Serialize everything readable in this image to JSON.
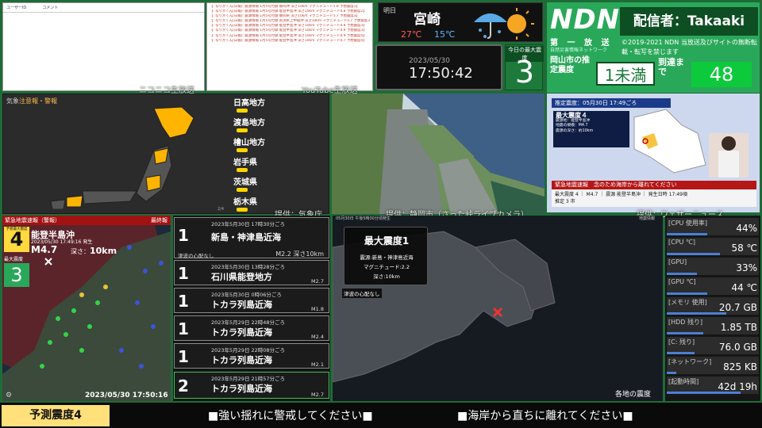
{
  "comments": {
    "col1": "ユーザーID",
    "col2": "コメント"
  },
  "log_lines": [
    "【: なりかくん[日報]: 震源情報 1月5号付録 静岡沖 深さ10km マグニチュード5.8 予想震度1】",
    "【: なりかくん[日報]: 震源情報 1月5号付録 能登半島沖 深さ10km マグニチュード4.8 予想震度2】",
    "【: なりかくん[日報]: 震源情報 1月5号付録 静岡県 深さ10km マグニチュード5.7 予想震度3】",
    "【: なりかくん[日報]: 震源情報 1月5号付録 新潟県上中越沖 深さ10km マグニチュード5.7 予想震度3】",
    "【: なりかくん[日報]: 震源情報 1月5号付録 能登半島沖 深さ10km マグニチュード4.8 予想震度3】",
    "【: なりかくん[日報]: 震源情報 1月5号付録 能登半島沖 深さ10km マグニチュード4.9 予想震度3】",
    "【: なりかくん[日報]: 震源情報 1月5号付録 能登半島沖 深さ10km マグニチュード4.9 予想震度4】",
    "【: なりかくん[日報]: 震源情報 1月5号付録 能登半島沖 深さ10km マグニチュード4.7 予想震度4】"
  ],
  "overlay": {
    "niconico": "ニコニコ生放送",
    "youtube": "YouTube生放送"
  },
  "weather": {
    "day": "明日",
    "city": "宮崎",
    "high": "27℃",
    "low": "15℃"
  },
  "clock": {
    "date": "2023/05/30",
    "time": "17:50:42"
  },
  "max_intensity": {
    "label": "今日の最大震度",
    "value": "3"
  },
  "header": {
    "logo": "NDN",
    "streamer": "配信者：Takaaki",
    "sub1": "第 一 放 送",
    "sub2": "自然災害情報ネットワーク",
    "copyright": "©2019-2021 NDN 当放送及びサイトの無断転載・転写を禁じます",
    "estimated_label": "岡山市の推定震度",
    "estimated_value": "1未満",
    "arrival_label": "到達まで",
    "arrival_value": "48"
  },
  "alert_map": {
    "title_prefix": "気象",
    "title_warn": "注意報・警報",
    "page": "2/4",
    "regions": [
      "日高地方",
      "渡島地方",
      "檜山地方",
      "岩手県",
      "茨城県",
      "栃木県"
    ]
  },
  "credits": {
    "jma": "提供：気象庁",
    "camera": "提供：静岡市（さった峠ライブカメラ）",
    "wni": "提供：ウェザーニュース"
  },
  "news": {
    "header": "推定震度：05月30日 17:49ごろ",
    "card_title": "最大震度４",
    "card_l1": "震源地：能登半島沖",
    "card_l2": "地震の規模：M4.7",
    "card_l3": "震源の深さ：約10km",
    "ticker_label": "緊急地震速報",
    "ticker_msg": "念のため海岸から離れてください",
    "info_line": "最大震度 4 ｜ M4.7 ｜ 震源 能登半島沖 ｜ 発生日時 17:49頃",
    "footer": "推定 3 市"
  },
  "eew": {
    "bar": "緊急地震速報（警報）",
    "final": "最終報",
    "pred_label": "予想最大震度",
    "pred_value": "4",
    "epicenter": "能登半島沖",
    "time": "2023/05/30 17:49:16 発生",
    "magnitude": "M4.7",
    "depth_label": "深さ：",
    "depth_value": "10km",
    "obs_label": "最大震度",
    "obs_value": "3",
    "timestamp": "2023/05/30 17:50:16"
  },
  "quake_list": [
    {
      "intensity": "1",
      "datetime": "2023年5月30日 17時30分ごろ",
      "place": "新島・神津島近海",
      "mag": "M2.2 深さ10km",
      "note": "津波の心配なし"
    },
    {
      "intensity": "1",
      "datetime": "2023年5月30日 13時28分ごろ",
      "place": "石川県能登地方",
      "mag": "M2.7"
    },
    {
      "intensity": "1",
      "datetime": "2023年5月30日 0時06分ごろ",
      "place": "トカラ列島近海",
      "mag": "M1.8"
    },
    {
      "intensity": "1",
      "datetime": "2023年5月29日 22時48分ごろ",
      "place": "トカラ列島近海",
      "mag": "M2.4"
    },
    {
      "intensity": "1",
      "datetime": "2023年5月29日 22時08分ごろ",
      "place": "トカラ列島近海",
      "mag": "M2.1"
    },
    {
      "intensity": "2",
      "datetime": "2023年5月29日 21時57分ごろ",
      "place": "トカラ列島近海",
      "mag": "M2.7"
    }
  ],
  "detail_map": {
    "header": "05月30日 午後5時30分頃発生",
    "brand": "地震情報",
    "card_title": "最大震度1",
    "card_l1": "震源:新島・神津島近海",
    "card_l2": "マグニチュード:2.2",
    "card_l3": "深さ:10km",
    "tsunami": "津波の心配なし",
    "footer": "各地の震度"
  },
  "stats": [
    {
      "key": "[CPU 使用率]",
      "value": "44%",
      "level": 0.44
    },
    {
      "key": "[CPU ℃]",
      "value": "58 ℃",
      "level": 0.58
    },
    {
      "key": "[GPU]",
      "value": "33%",
      "level": 0.33
    },
    {
      "key": "[GPU ℃]",
      "value": "44 ℃",
      "level": 0.44
    },
    {
      "key": "[メモリ 使用]",
      "value": "20.7 GB",
      "level": 0.65
    },
    {
      "key": "[HDD 残り]",
      "value": "1.85 TB",
      "level": 0.4
    },
    {
      "key": "[C: 残り]",
      "value": "76.0 GB",
      "level": 0.3
    },
    {
      "key": "[ネットワーク]",
      "value": "825 KB",
      "level": 0.1
    },
    {
      "key": "[起動時間]",
      "value": "42d 19h",
      "level": 0.8
    }
  ],
  "bottom": {
    "pred": "予測震度4",
    "msg1": "■強い揺れに警戒してください■",
    "msg2": "■海岸から直ちに離れてください■"
  }
}
